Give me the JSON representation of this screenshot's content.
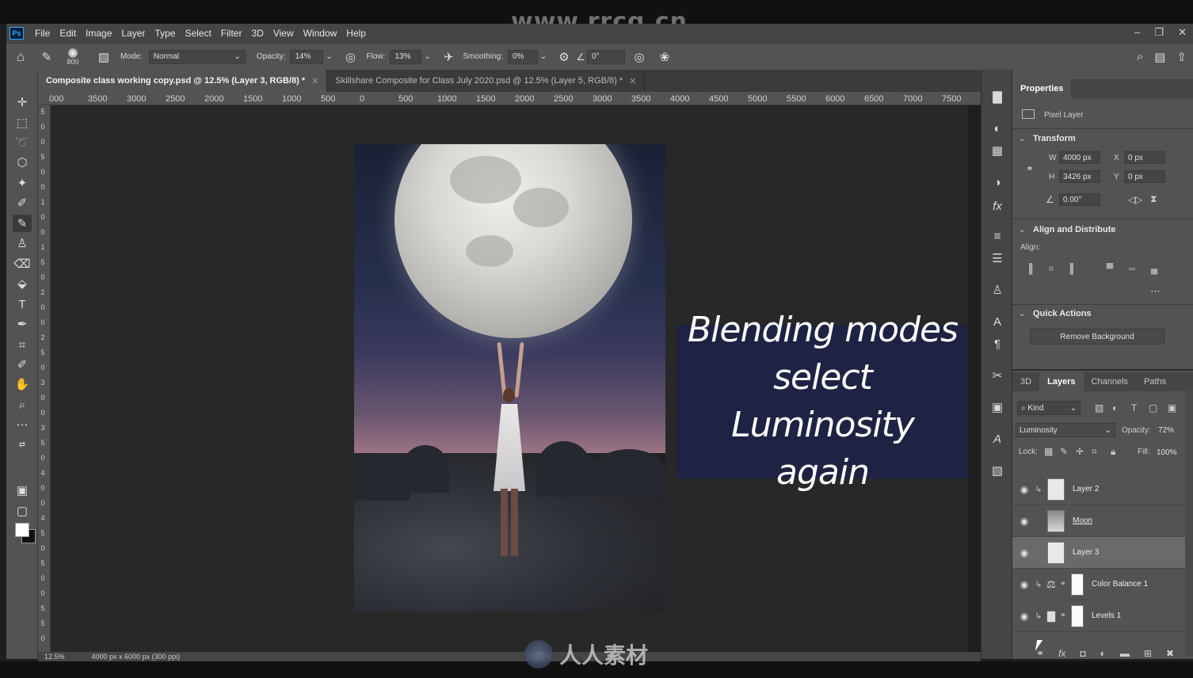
{
  "watermark": {
    "top": "www.rrcg.cn",
    "bottom": "人人素材"
  },
  "app": {
    "logo": "Ps"
  },
  "menu": [
    "File",
    "Edit",
    "Image",
    "Layer",
    "Type",
    "Select",
    "Filter",
    "3D",
    "View",
    "Window",
    "Help"
  ],
  "options": {
    "brush_size": "800",
    "mode_label": "Mode:",
    "mode_value": "Normal",
    "opacity_label": "Opacity:",
    "opacity_value": "14%",
    "flow_label": "Flow:",
    "flow_value": "13%",
    "smoothing_label": "Smoothing:",
    "smoothing_value": "0%",
    "angle_value": "0°"
  },
  "tabs": [
    {
      "label": "Composite class working copy.psd @ 12.5% (Layer 3, RGB/8) *",
      "active": true
    },
    {
      "label": "Skillshare Composite for Class July 2020.psd @ 12.5% (Layer 5, RGB/8) *",
      "active": false
    }
  ],
  "ruler_h": [
    "000",
    "3500",
    "3000",
    "2500",
    "2000",
    "1500",
    "1000",
    "500",
    "0",
    "500",
    "1000",
    "1500",
    "2000",
    "2500",
    "3000",
    "3500",
    "4000",
    "4500",
    "5000",
    "5500",
    "6000",
    "6500",
    "7000",
    "7500"
  ],
  "ruler_v": [
    "5",
    "0",
    "0",
    "5",
    "0",
    "0",
    "1",
    "0",
    "0",
    "1",
    "5",
    "0",
    "2",
    "0",
    "0",
    "2",
    "5",
    "0",
    "3",
    "0",
    "0",
    "3",
    "5",
    "0",
    "4",
    "0",
    "0",
    "4",
    "5",
    "0",
    "5",
    "0",
    "0",
    "5",
    "5",
    "0"
  ],
  "caption": {
    "line1": "Blending modes",
    "line2": "select Luminosity",
    "line3": "again"
  },
  "status": {
    "zoom": "12.5%",
    "doc_info": "4000 px x 6000 px (300 ppi)"
  },
  "properties": {
    "title": "Properties",
    "kind": "Pixel Layer",
    "transform": {
      "title": "Transform",
      "w_label": "W",
      "w_value": "4000 px",
      "h_label": "H",
      "h_value": "3426 px",
      "x_label": "X",
      "x_value": "0 px",
      "y_label": "Y",
      "y_value": "0 px",
      "angle_value": "0.00°"
    },
    "align": {
      "title": "Align and Distribute",
      "label": "Align:"
    },
    "quick_actions": {
      "title": "Quick Actions",
      "button": "Remove Background"
    }
  },
  "layers_panel": {
    "tabs": [
      "3D",
      "Layers",
      "Channels",
      "Paths"
    ],
    "active_tab": "Layers",
    "filter_kind": "Kind",
    "blend_mode": "Luminosity",
    "opacity_label": "Opacity:",
    "opacity_value": "72%",
    "lock_label": "Lock:",
    "fill_label": "Fill:",
    "fill_value": "100%",
    "layers": [
      {
        "name": "Layer 2",
        "type": "pixel",
        "clipped": true,
        "selected": false
      },
      {
        "name": "Moon",
        "type": "smart",
        "clipped": false,
        "selected": false
      },
      {
        "name": "Layer 3",
        "type": "pixel",
        "clipped": false,
        "selected": true
      },
      {
        "name": "Color Balance 1",
        "type": "adjustment",
        "icon": "balance-icon",
        "clipped": true,
        "selected": false
      },
      {
        "name": "Levels 1",
        "type": "adjustment",
        "icon": "levels-icon",
        "clipped": true,
        "selected": false
      }
    ]
  },
  "colors": {
    "accent": "#31a8ff",
    "canvas_bg": "#282828",
    "panel_bg": "#535353",
    "caption_bg": "#1e2344"
  }
}
